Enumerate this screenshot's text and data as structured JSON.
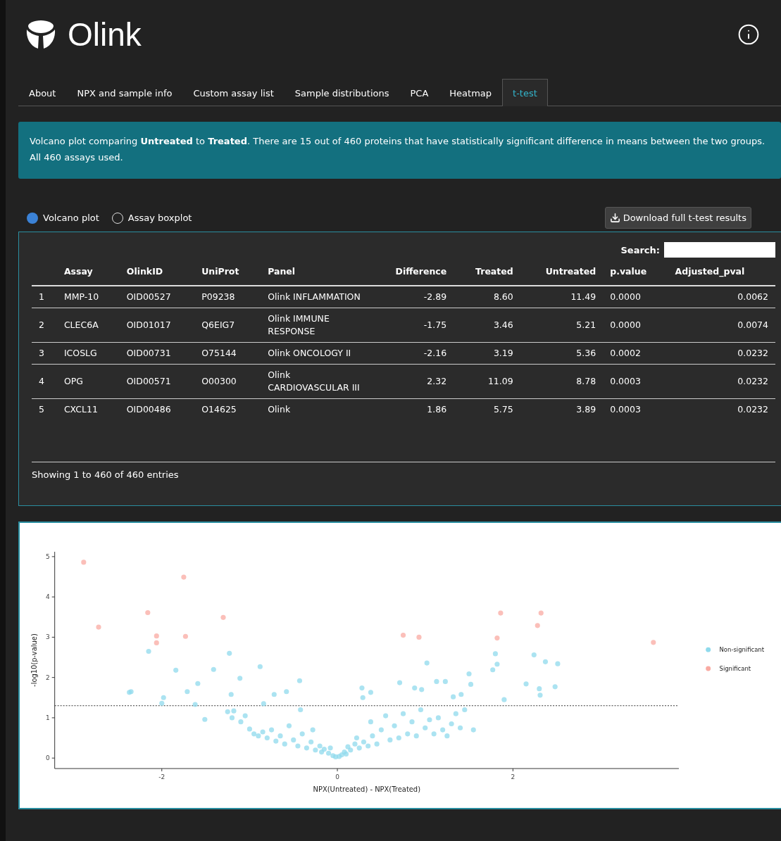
{
  "header": {
    "logo_text": "Olink"
  },
  "tabs": [
    {
      "label": "About",
      "selected": false
    },
    {
      "label": "NPX and sample info",
      "selected": false
    },
    {
      "label": "Custom assay list",
      "selected": false
    },
    {
      "label": "Sample distributions",
      "selected": false
    },
    {
      "label": "PCA",
      "selected": false
    },
    {
      "label": "Heatmap",
      "selected": false
    },
    {
      "label": "t-test",
      "selected": true
    }
  ],
  "banner": "Volcano plot comparing **Untreated** to **Treated**. There are 15 out of 460 proteins that have statistically significant difference in means between the two groups. All 460 assays used.",
  "view_options": [
    {
      "label": "Volcano plot",
      "selected": true
    },
    {
      "label": "Assay boxplot",
      "selected": false
    }
  ],
  "download_button": "Download full t-test results",
  "table": {
    "search_label": "Search:",
    "columns": [
      "Assay",
      "OlinkID",
      "UniProt",
      "Panel",
      "Difference",
      "Treated",
      "Untreated",
      "p.value",
      "Adjusted_pval"
    ],
    "rows": [
      {
        "index": "1",
        "cells": [
          "MMP-10",
          "OID00527",
          "P09238",
          "Olink INFLAMMATION",
          "-2.89",
          "8.60",
          "11.49",
          "0.0000",
          "0.0062"
        ]
      },
      {
        "index": "2",
        "cells": [
          "CLEC6A",
          "OID01017",
          "Q6EIG7",
          "Olink IMMUNE RESPONSE",
          "-1.75",
          "3.46",
          "5.21",
          "0.0000",
          "0.0074"
        ]
      },
      {
        "index": "3",
        "cells": [
          "ICOSLG",
          "OID00731",
          "O75144",
          "Olink ONCOLOGY II",
          "-2.16",
          "3.19",
          "5.36",
          "0.0002",
          "0.0232"
        ]
      },
      {
        "index": "4",
        "cells": [
          "OPG",
          "OID00571",
          "O00300",
          "Olink CARDIOVASCULAR III",
          "2.32",
          "11.09",
          "8.78",
          "0.0003",
          "0.0232"
        ]
      },
      {
        "index": "5",
        "cells": [
          "CXCL11",
          "OID00486",
          "O14625",
          "Olink",
          "1.86",
          "5.75",
          "3.89",
          "0.0003",
          "0.0232"
        ]
      }
    ],
    "info": "Showing 1 to 460 of 460 entries"
  },
  "plot": {
    "chart_data": {
      "type": "scatter",
      "xlabel": "NPX(Untreated) - NPX(Treated)",
      "ylabel": "-log10(p-value)",
      "xlim": [
        -3.22,
        3.89
      ],
      "ylim": [
        -0.26,
        5.12
      ],
      "xticks": [
        -2,
        0,
        2
      ],
      "yticks": [
        0,
        1,
        2,
        3,
        4,
        5
      ],
      "ref_lines": [
        {
          "axis": "y",
          "value": 1.3
        }
      ],
      "legend": "right",
      "series": [
        {
          "name": "Non-significant",
          "color": "#8fdaec",
          "x": [
            -2.35,
            -2.37,
            -2.15,
            -1.98,
            -2.0,
            -1.84,
            -1.71,
            -1.59,
            -1.62,
            -1.51,
            -1.41,
            -1.23,
            -1.11,
            -1.21,
            -0.88,
            -0.84,
            -0.72,
            -0.58,
            -0.43,
            0.28,
            0.29,
            0.38,
            0.71,
            0.88,
            0.96,
            1.02,
            1.13,
            1.23,
            1.32,
            1.5,
            1.52,
            1.41,
            1.8,
            1.82,
            1.77,
            1.9,
            2.15,
            2.24,
            2.37,
            2.51,
            2.3,
            2.31,
            2.48,
            -1.25,
            -1.2,
            -1.18,
            -1.1,
            -1.05,
            -1.0,
            -0.95,
            -0.9,
            -0.85,
            -0.8,
            -0.75,
            -0.7,
            -0.65,
            -0.6,
            -0.55,
            -0.5,
            -0.45,
            -0.42,
            -0.4,
            -0.35,
            -0.3,
            -0.28,
            -0.25,
            -0.2,
            -0.18,
            -0.15,
            -0.1,
            -0.08,
            -0.05,
            -0.02,
            0.02,
            0.05,
            0.08,
            0.1,
            0.12,
            0.15,
            0.2,
            0.22,
            0.25,
            0.3,
            0.35,
            0.38,
            0.4,
            0.45,
            0.5,
            0.55,
            0.6,
            0.65,
            0.7,
            0.75,
            0.8,
            0.85,
            0.9,
            0.95,
            1.0,
            1.05,
            1.1,
            1.15,
            1.2,
            1.25,
            1.3,
            1.35,
            1.4,
            1.45,
            1.55
          ],
          "values": [
            1.65,
            1.63,
            2.65,
            1.5,
            1.36,
            2.18,
            1.65,
            1.85,
            1.33,
            0.96,
            2.2,
            2.6,
            1.98,
            1.58,
            2.27,
            1.35,
            1.58,
            1.65,
            1.92,
            1.74,
            1.5,
            1.63,
            1.87,
            1.74,
            1.7,
            2.36,
            1.9,
            1.9,
            1.52,
            2.09,
            1.83,
            1.58,
            2.59,
            2.33,
            2.19,
            1.45,
            1.84,
            2.56,
            2.39,
            2.34,
            1.72,
            1.56,
            1.77,
            1.15,
            1.0,
            1.17,
            0.9,
            1.05,
            0.72,
            0.6,
            0.55,
            0.65,
            0.5,
            0.7,
            0.42,
            0.55,
            0.35,
            0.8,
            0.45,
            0.3,
            1.2,
            0.6,
            0.25,
            0.4,
            0.7,
            0.2,
            0.3,
            0.15,
            0.22,
            0.12,
            0.25,
            0.06,
            0.03,
            0.04,
            0.08,
            0.15,
            0.1,
            0.28,
            0.2,
            0.35,
            0.5,
            0.25,
            0.4,
            0.3,
            0.9,
            0.55,
            0.35,
            0.7,
            1.05,
            0.45,
            0.8,
            0.5,
            1.1,
            0.6,
            0.9,
            0.55,
            1.2,
            0.75,
            0.95,
            0.6,
            1.0,
            0.7,
            0.55,
            0.85,
            1.1,
            0.75,
            1.2,
            0.7
          ]
        },
        {
          "name": "Significant",
          "color": "#f9aaa2",
          "x": [
            -2.89,
            -2.72,
            -2.16,
            -2.06,
            -2.06,
            -1.75,
            -1.73,
            -1.3,
            0.75,
            0.93,
            1.82,
            1.86,
            2.28,
            2.32,
            3.6
          ],
          "values": [
            4.86,
            3.25,
            3.61,
            3.03,
            2.86,
            4.49,
            3.02,
            3.49,
            3.05,
            3.0,
            2.98,
            3.6,
            3.29,
            3.6,
            2.87
          ]
        }
      ]
    }
  }
}
